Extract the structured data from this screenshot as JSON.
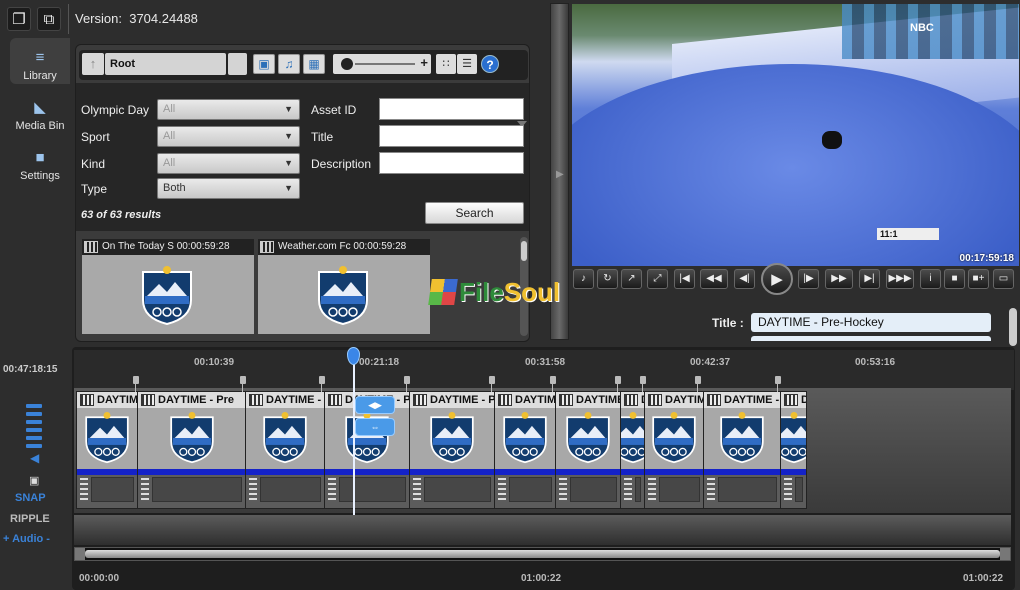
{
  "header": {
    "version_label": "Version:",
    "version_value": "3704.24488",
    "new_icon": "new-window-icon",
    "popout_icon": "popout-icon"
  },
  "nav": {
    "items": [
      {
        "label": "Library",
        "icon": "library-icon"
      },
      {
        "label": "Media Bin",
        "icon": "folder-icon"
      },
      {
        "label": "Settings",
        "icon": "speech-bubble-icon"
      }
    ]
  },
  "library": {
    "breadcrumb": "Root",
    "filters": {
      "olympic_day": {
        "label": "Olympic Day",
        "value": "All"
      },
      "sport": {
        "label": "Sport",
        "value": "All"
      },
      "kind": {
        "label": "Kind",
        "value": "All"
      },
      "type": {
        "label": "Type",
        "value": "Both"
      },
      "asset_id": {
        "label": "Asset ID",
        "value": ""
      },
      "title": {
        "label": "Title",
        "value": ""
      },
      "description": {
        "label": "Description",
        "value": ""
      }
    },
    "results": "63 of 63 results",
    "search_label": "Search",
    "assets": [
      {
        "title": "On The Today S",
        "duration": "00:00:59:28"
      },
      {
        "title": "Weather.com Fc",
        "duration": "00:00:59:28"
      }
    ]
  },
  "player": {
    "overlay_time": "00:17:59:18",
    "scorebug": "11:1",
    "network_logo": "NBC",
    "title_label": "Title :",
    "title_value": "DAYTIME - Pre-Hockey"
  },
  "timeline": {
    "current_time": "00:47:18:15",
    "ruler_ticks": [
      "00:10:39",
      "00:21:18",
      "00:31:58",
      "00:42:37",
      "00:53:16"
    ],
    "clips": [
      {
        "title": "DAYTIME - Pre"
      },
      {
        "title": "DAYTIME - Pre"
      },
      {
        "title": "DAYTIME - Pre"
      },
      {
        "title": "DAYTIME - Pre"
      },
      {
        "title": "DAYTIME - Pre"
      },
      {
        "title": "DAYTIME - Pre"
      },
      {
        "title": "DAYTIME - Pre"
      },
      {
        "title": "DAYTIME - Pre"
      },
      {
        "title": "DAYTIME - Pre"
      },
      {
        "title": "DAYTIME - Pre"
      },
      {
        "title": "DAYTIME - Pre"
      }
    ],
    "snap_label": "SNAP",
    "ripple_label": "RIPPLE",
    "audio_label": "+ Audio -",
    "bottom_times": [
      "00:00:00",
      "01:00:22",
      "01:00:22"
    ]
  },
  "watermark": {
    "text_a": "File",
    "text_b": "Soul"
  },
  "colors": {
    "accent": "#3a82d8",
    "clip_bar": "#1422c8",
    "title_box": "#e4eef8"
  }
}
